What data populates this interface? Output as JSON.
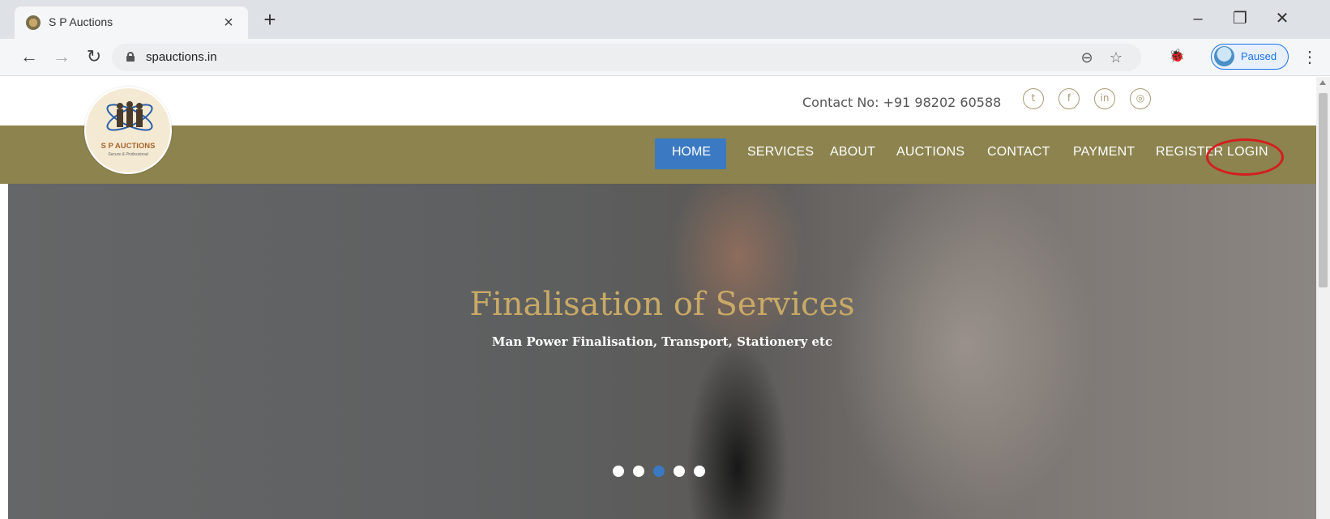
{
  "browser": {
    "tab": {
      "title": "S P Auctions",
      "close_glyph": "×"
    },
    "new_tab_glyph": "+",
    "window_controls": {
      "minimize": "–",
      "restore": "❐",
      "close": "✕"
    },
    "nav": {
      "back": "←",
      "forward": "→",
      "reload": "↻"
    },
    "url": "spauctions.in",
    "omnibox_icons": {
      "zoom": "zoom-icon",
      "bookmark": "star-icon",
      "zoom_glyph": "⊖",
      "star_glyph": "☆"
    },
    "extension_glyph": "🐞",
    "profile_label": "Paused",
    "menu_glyph": "⋮"
  },
  "site": {
    "logo": {
      "title": "S P AUCTIONS",
      "tagline": "Secure & Professional"
    },
    "contact": "Contact No: +91 98202 60588",
    "social": [
      {
        "name": "twitter-icon",
        "glyph": "t"
      },
      {
        "name": "facebook-icon",
        "glyph": "f"
      },
      {
        "name": "linkedin-icon",
        "glyph": "in"
      },
      {
        "name": "dribbble-icon",
        "glyph": "◎"
      }
    ],
    "nav": [
      "HOME",
      "SERVICES",
      "ABOUT",
      "AUCTIONS",
      "CONTACT",
      "PAYMENT",
      "REGISTER",
      "LOGIN"
    ],
    "active_nav": "HOME",
    "hero": {
      "title": "Finalisation of Services",
      "subtitle": "Man Power Finalisation, Transport, Stationery etc",
      "slide_count": 5,
      "active_slide": 3
    },
    "colors": {
      "navbar": "#8c834e",
      "active": "#3b7ac2",
      "accent_title": "#c8a966",
      "highlight": "#d31f1f"
    }
  }
}
